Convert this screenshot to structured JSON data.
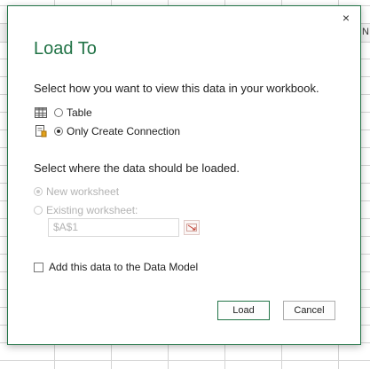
{
  "sheet": {
    "column_letter": "N"
  },
  "dialog": {
    "title": "Load To",
    "close_symbol": "×",
    "view_prompt": "Select how you want to view this data in your workbook.",
    "view_options": [
      {
        "label": "Table",
        "icon": "table-icon",
        "selected": false
      },
      {
        "label": "Only Create Connection",
        "icon": "connection-icon",
        "selected": true
      }
    ],
    "load_prompt": "Select where the data should be loaded.",
    "load_options": [
      {
        "label": "New worksheet",
        "selected": true,
        "disabled": true
      },
      {
        "label": "Existing worksheet:",
        "selected": false,
        "disabled": true
      }
    ],
    "cell_reference": "$A$1",
    "data_model_label": "Add this data to the Data Model",
    "data_model_checked": false,
    "load_button": "Load",
    "cancel_button": "Cancel"
  },
  "colors": {
    "accent": "#217346",
    "disabled_text": "#b3b3b3"
  }
}
